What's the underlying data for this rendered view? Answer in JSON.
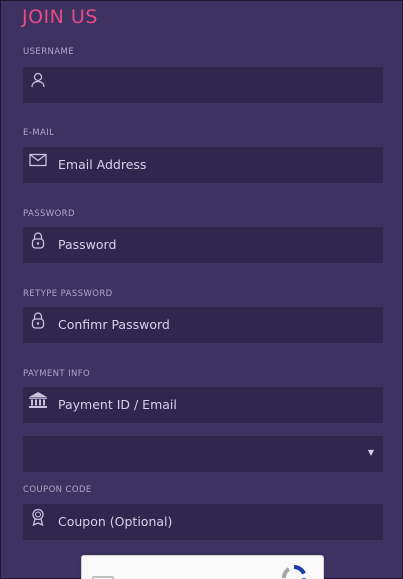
{
  "form": {
    "title": "JOIN US",
    "username": {
      "label": "USERNAME",
      "placeholder": "",
      "icon": "user-icon"
    },
    "email": {
      "label": "E-MAIL",
      "placeholder": "Email Address",
      "icon": "envelope-icon"
    },
    "password": {
      "label": "PASSWORD",
      "placeholder": "Password",
      "icon": "lock-icon"
    },
    "retype_password": {
      "label": "RETYPE PASSWORD",
      "placeholder": "Confimr Password",
      "icon": "lock-icon"
    },
    "payment": {
      "label": "PAYMENT INFO",
      "placeholder": "Payment ID / Email",
      "icon": "bank-icon"
    },
    "payment_select": {
      "value": "",
      "arrow": "▼"
    },
    "coupon": {
      "label": "COUPON CODE",
      "placeholder": "Coupon (Optional)",
      "icon": "badge-icon"
    }
  },
  "colors": {
    "background": "#3e3263",
    "field": "#30264e",
    "accent": "#e84c84",
    "label": "#b0a7c7",
    "text": "#d8d2e8"
  }
}
